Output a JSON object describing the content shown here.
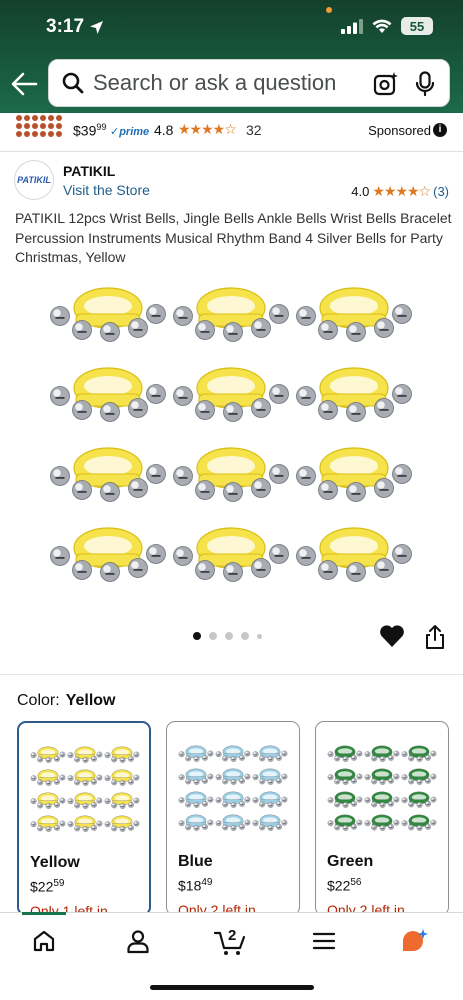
{
  "status": {
    "time": "3:17",
    "battery": "55"
  },
  "search": {
    "placeholder": "Search or ask a question"
  },
  "ad": {
    "price_whole": "$39",
    "price_fraction": "99",
    "prime": "✓prime",
    "rating": "4.8",
    "stars": "★★★★☆",
    "review_count": "32",
    "sponsored": "Sponsored"
  },
  "brand": {
    "logo_text": "PATIKIL",
    "name": "PATIKIL",
    "store_link": "Visit the Store",
    "rating": "4.0",
    "stars": "★★★★☆",
    "review_count": "(3)"
  },
  "product": {
    "title": "PATIKIL 12pcs Wrist Bells, Jingle Bells Ankle Bells Wrist Bells Bracelet Percussion Instruments Musical Rhythm Band 4 Silver Bells for Party Christmas, Yellow",
    "image_count": 5,
    "active_image": 1
  },
  "variation": {
    "label": "Color:",
    "selected": "Yellow"
  },
  "swatches": [
    {
      "name": "Yellow",
      "price_whole": "$22",
      "price_fraction": "59",
      "stock": "Only 1 left in",
      "color": "#f6e24a",
      "selected": true
    },
    {
      "name": "Blue",
      "price_whole": "$18",
      "price_fraction": "49",
      "stock": "Only 2 left in",
      "color": "#9ccfe6",
      "selected": false
    },
    {
      "name": "Green",
      "price_whole": "$22",
      "price_fraction": "56",
      "stock": "Only 2 left in",
      "color": "#2f8a3e",
      "selected": false
    }
  ],
  "tabbar": {
    "cart_count": "2",
    "icons": [
      "home-icon",
      "account-icon",
      "cart-icon",
      "menu-icon",
      "rufus-icon"
    ]
  },
  "colors": {
    "header": "#17553a",
    "accent_teal": "#16734c",
    "link": "#1f5e8a",
    "price_red": "#b12704",
    "star": "#de7921"
  }
}
